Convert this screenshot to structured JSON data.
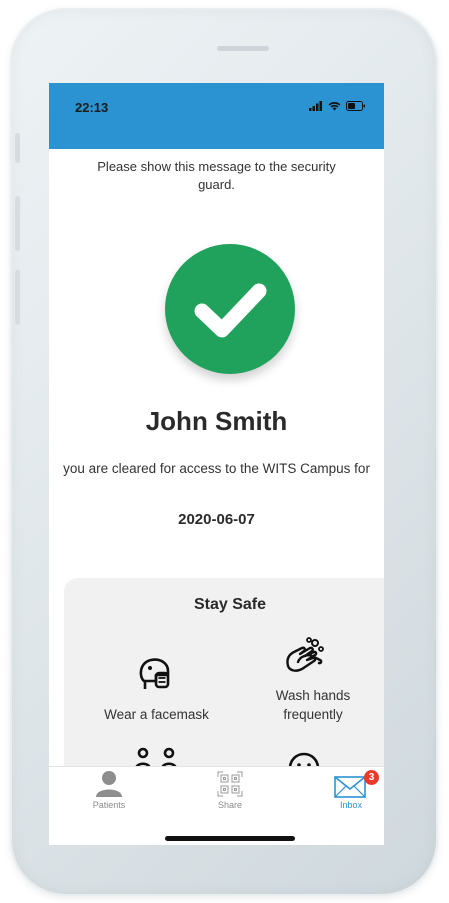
{
  "status_bar": {
    "time": "22:13"
  },
  "message": "Please show this message to the security guard.",
  "person": {
    "name": "John Smith"
  },
  "clearance": {
    "text": "you are cleared for access to the WITS Campus for",
    "date": "2020-06-07"
  },
  "stay_safe": {
    "title": "Stay Safe",
    "tips": [
      {
        "label": "Wear a facemask",
        "icon": "facemask-icon"
      },
      {
        "label": "Wash hands frequently",
        "icon": "wash-hands-icon"
      },
      {
        "label": "",
        "icon": "social-distance-icon"
      },
      {
        "label": "",
        "icon": "face-icon"
      }
    ]
  },
  "tabbar": {
    "tabs": [
      {
        "label": "Patients",
        "icon": "person-icon",
        "active": false
      },
      {
        "label": "Share",
        "icon": "qr-code-icon",
        "active": false
      },
      {
        "label": "Inbox",
        "icon": "envelope-icon",
        "active": true,
        "badge": "3"
      }
    ]
  },
  "colors": {
    "status_bar": "#2b93d1",
    "check": "#20a15c",
    "badge": "#ea3a2a",
    "active_tab": "#2b93d1"
  }
}
